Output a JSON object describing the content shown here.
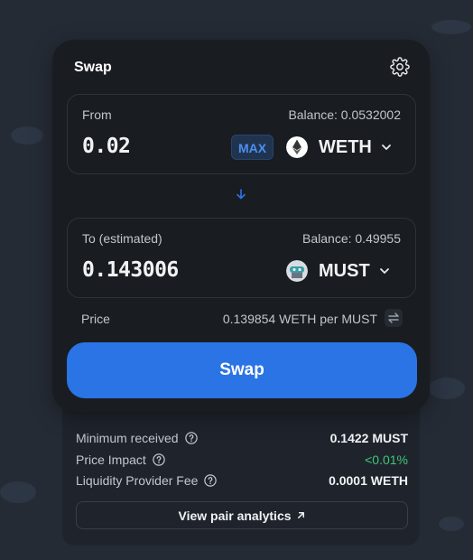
{
  "card": {
    "title": "Swap"
  },
  "from": {
    "label": "From",
    "balance": "Balance: 0.0532002",
    "amount": "0.02",
    "max_label": "MAX",
    "token": "WETH"
  },
  "to": {
    "label": "To (estimated)",
    "balance": "Balance: 0.49955",
    "amount": "0.143006",
    "token": "MUST"
  },
  "price": {
    "label": "Price",
    "value": "0.139854 WETH per MUST"
  },
  "swap_button": "Swap",
  "details": {
    "rows": [
      {
        "label": "Minimum received",
        "value": "0.1422 MUST",
        "status": "normal"
      },
      {
        "label": "Price Impact",
        "value": "<0.01%",
        "status": "positive"
      },
      {
        "label": "Liquidity Provider Fee",
        "value": "0.0001 WETH",
        "status": "normal"
      }
    ],
    "analytics_link": "View pair analytics"
  },
  "icons": {
    "settings": "gear-icon",
    "eth": "ethereum-icon",
    "must": "must-token-icon",
    "direction": "arrow-down-icon",
    "invert": "swap-arrows-icon",
    "help": "question-circle-icon",
    "external": "arrow-up-right-icon"
  },
  "colors": {
    "accent": "#2a74e6",
    "positive": "#3cc878",
    "card_bg": "#191c21",
    "page_bg": "#252b35"
  }
}
